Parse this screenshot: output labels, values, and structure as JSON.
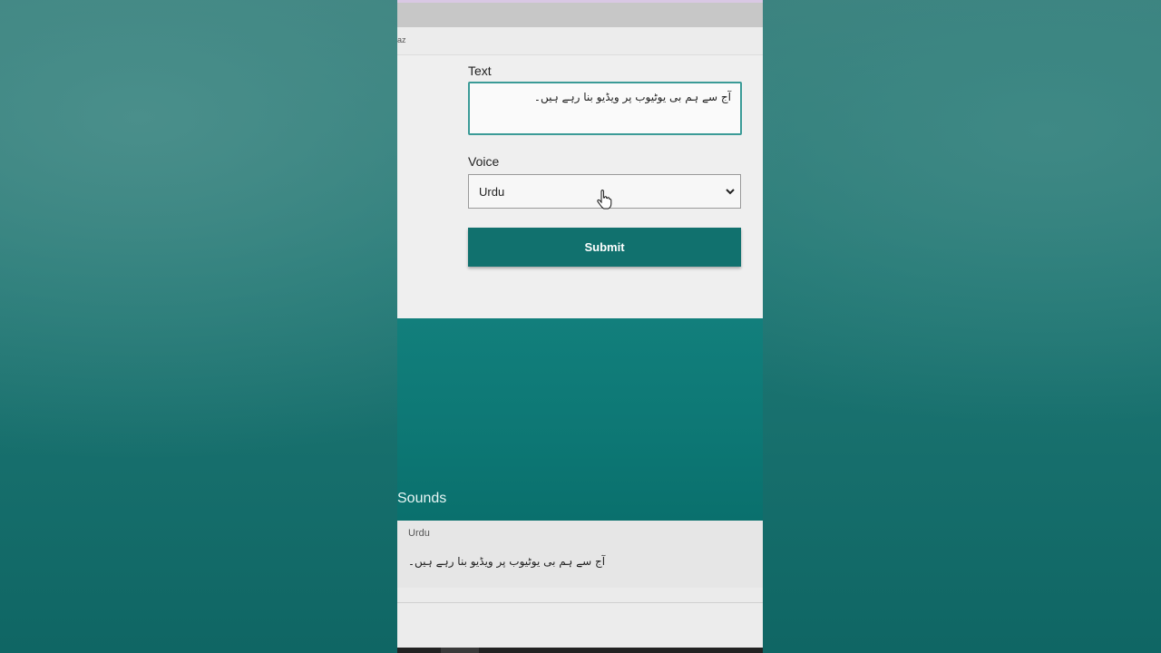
{
  "subbar": {
    "label": "az"
  },
  "form": {
    "text_label": "Text",
    "text_value": "آج سے ہم بی یوٹیوب پر ویڈیو بنا رہے ہیں۔",
    "voice_label": "Voice",
    "voice_selected": "Urdu",
    "submit_label": "Submit"
  },
  "sounds": {
    "title": "Sounds",
    "items": [
      {
        "voice": "Urdu",
        "text": "آج سے ہم بی یوٹیوب پر ویڈیو بنا رہے ہیں۔"
      }
    ]
  },
  "colors": {
    "accent": "#11716e",
    "input_focus": "#3b9b97",
    "backdrop": "#16716f"
  },
  "icons": {
    "select_arrow": "chevron-down-icon",
    "mouse_pointer": "hand-pointer-icon"
  }
}
